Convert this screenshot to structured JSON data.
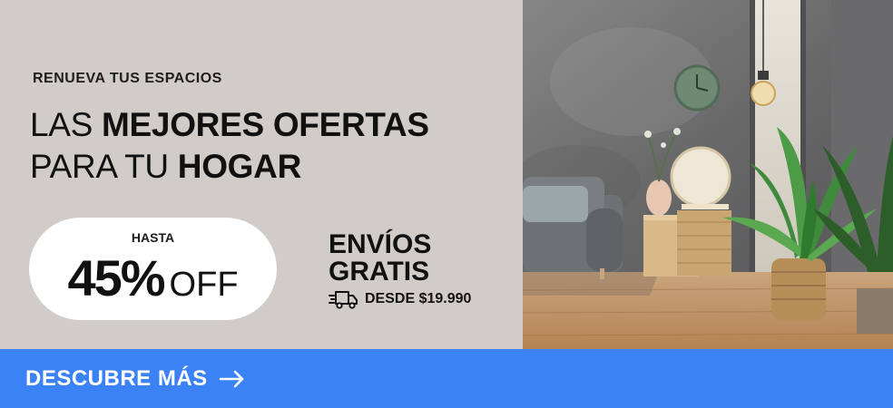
{
  "banner": {
    "eyebrow": "RENUEVA TUS ESPACIOS",
    "headline": {
      "line1_regular": "LAS ",
      "line1_bold": "MEJORES OFERTAS",
      "line2_regular": "PARA TU ",
      "line2_bold": "HOGAR"
    },
    "discount": {
      "prefix": "HASTA",
      "percent": "45%",
      "suffix": "OFF"
    },
    "shipping": {
      "line1": "ENVÍOS",
      "line2": "GRATIS",
      "from": "DESDE $19.990",
      "icon": "delivery-truck-icon"
    },
    "cta": {
      "label": "DESCUBRE MÁS",
      "icon": "arrow-right-icon"
    },
    "colors": {
      "background": "#d2ccc8",
      "cta": "#3b82f6",
      "pill": "#ffffff",
      "text": "#111111"
    }
  }
}
